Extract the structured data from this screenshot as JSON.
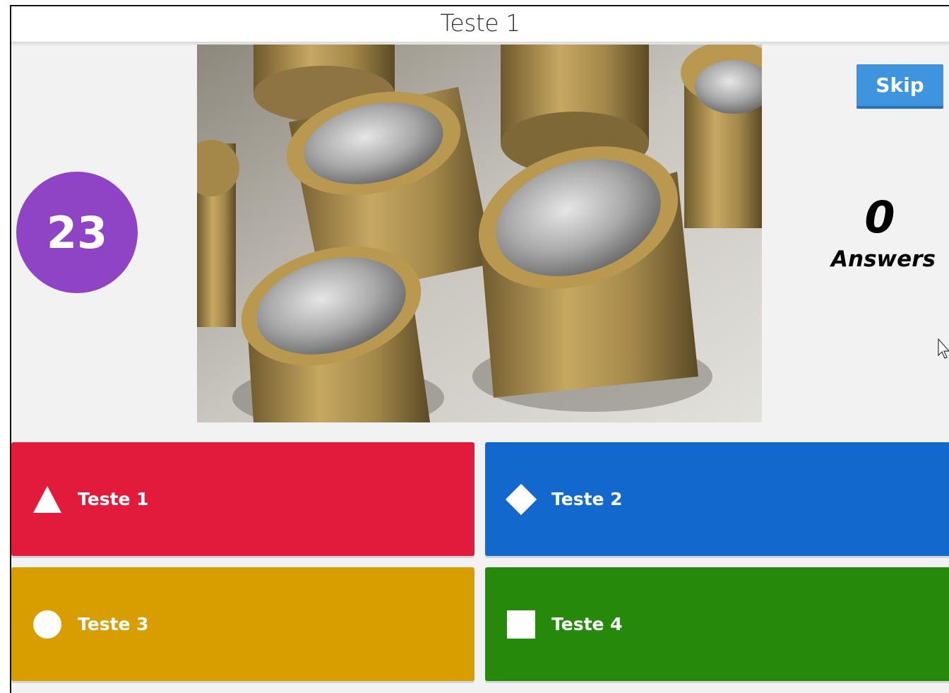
{
  "header": {
    "title": "Teste 1"
  },
  "timer": {
    "seconds": "23",
    "color": "#8e44c4"
  },
  "media": {
    "description_icon": "coins-image"
  },
  "controls": {
    "skip_label": "Skip"
  },
  "stats": {
    "answers_count": "0",
    "answers_label": "Answers"
  },
  "answers": [
    {
      "label": "Teste 1",
      "shape": "triangle-icon",
      "color": "#e21b3c"
    },
    {
      "label": "Teste 2",
      "shape": "diamond-icon",
      "color": "#1368ce"
    },
    {
      "label": "Teste 3",
      "shape": "circle-icon",
      "color": "#d89e00"
    },
    {
      "label": "Teste 4",
      "shape": "square-icon",
      "color": "#26890c"
    }
  ]
}
